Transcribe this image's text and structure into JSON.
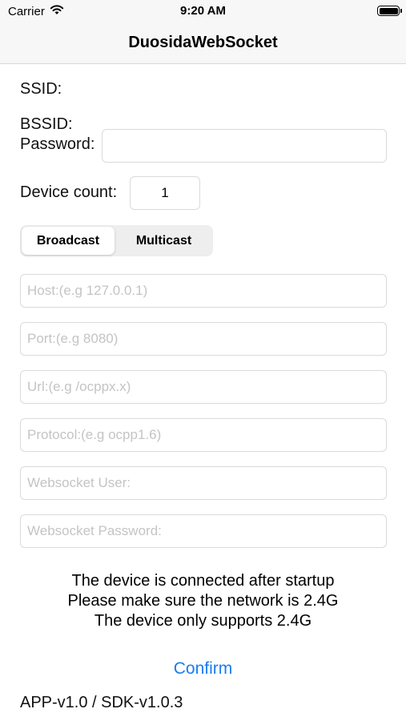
{
  "status_bar": {
    "carrier": "Carrier",
    "time": "9:20 AM",
    "wifi_icon": "wifi-icon",
    "battery_icon": "battery-icon",
    "battery_level": 1.0
  },
  "nav": {
    "title": "DuosidaWebSocket"
  },
  "form": {
    "ssid_label": "SSID:",
    "bssid_label": "BSSID:",
    "password_label": "Password:",
    "password_value": "",
    "device_count_label": "Device count:",
    "device_count_value": "1",
    "segments": {
      "selected": "Broadcast",
      "other": "Multicast"
    },
    "host_placeholder": "Host:(e.g 127.0.0.1)",
    "port_placeholder": "Port:(e.g 8080)",
    "url_placeholder": "Url:(e.g /ocppx.x)",
    "protocol_placeholder": "Protocol:(e.g ocpp1.6)",
    "ws_user_placeholder": "Websocket User:",
    "ws_password_placeholder": "Websocket Password:"
  },
  "info": {
    "line1": "The device is connected after startup",
    "line2": "Please make sure the network is 2.4G",
    "line3": "The device only supports 2.4G"
  },
  "confirm_label": "Confirm",
  "version": "APP-v1.0 / SDK-v1.0.3",
  "colors": {
    "accent": "#1a7cf0",
    "bar_background": "#f7f7f7",
    "placeholder": "#c4c4c6"
  }
}
